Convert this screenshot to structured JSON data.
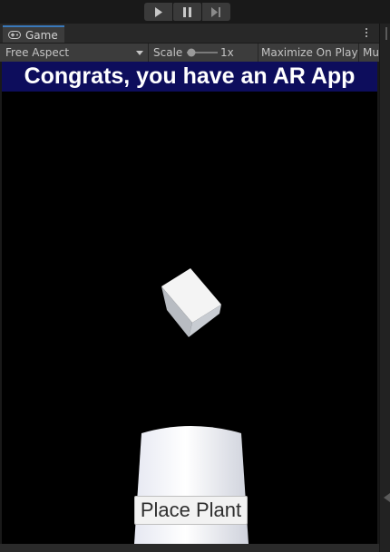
{
  "toolbar": {
    "play_icon": "play-icon",
    "pause_icon": "pause-icon",
    "step_icon": "step-icon"
  },
  "tab": {
    "label": "Game",
    "icon": "gamepad-icon"
  },
  "game_toolbar": {
    "aspect": "Free Aspect",
    "scale_label": "Scale",
    "scale_value": "1x",
    "maximize": "Maximize On Play",
    "mute": "Mu"
  },
  "scene": {
    "banner": "Congrats, you have an AR App",
    "place_button": "Place Plant",
    "banner_color": "#0d0d5c",
    "accent_color": "#3a79bb"
  }
}
